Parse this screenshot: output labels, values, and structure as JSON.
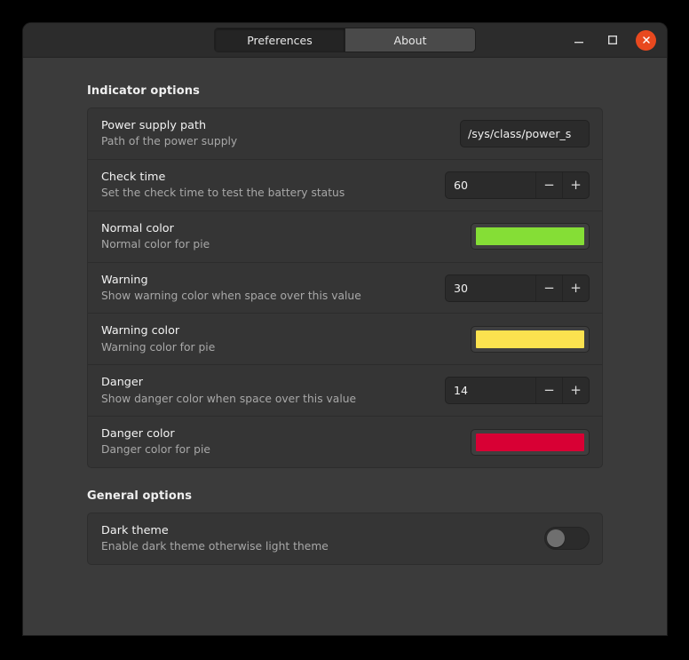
{
  "window": {
    "titlebar": {
      "tabs": [
        {
          "label": "Preferences",
          "active": true
        },
        {
          "label": "About",
          "active": false
        }
      ],
      "buttons": {
        "minimize": "minimize-icon",
        "maximize": "maximize-icon",
        "close": "close-icon"
      }
    }
  },
  "sections": [
    {
      "title": "Indicator options",
      "rows": [
        {
          "title": "Power supply path",
          "subtitle": "Path of the power supply",
          "control": "entry",
          "value": "/sys/class/power_s",
          "placeholder": "/sys/class/power_supply"
        },
        {
          "title": "Check time",
          "subtitle": "Set the check time to test the battery status",
          "control": "spin",
          "value": "60",
          "minus_label": "−",
          "plus_label": "+"
        },
        {
          "title": "Normal color",
          "subtitle": "Normal color for pie",
          "control": "color",
          "value": "#85de36"
        },
        {
          "title": "Warning",
          "subtitle": "Show warning color when space over this value",
          "control": "spin",
          "value": "30",
          "minus_label": "−",
          "plus_label": "+"
        },
        {
          "title": "Warning color",
          "subtitle": "Warning color for pie",
          "control": "color",
          "value": "#fbe24f"
        },
        {
          "title": "Danger",
          "subtitle": "Show danger color when space over this value",
          "control": "spin",
          "value": "14",
          "minus_label": "−",
          "plus_label": "+"
        },
        {
          "title": "Danger color",
          "subtitle": "Danger color for pie",
          "control": "color",
          "value": "#d80034"
        }
      ]
    },
    {
      "title": "General options",
      "rows": [
        {
          "title": "Dark theme",
          "subtitle": "Enable dark theme otherwise light theme",
          "control": "switch",
          "value": "off"
        }
      ]
    }
  ]
}
